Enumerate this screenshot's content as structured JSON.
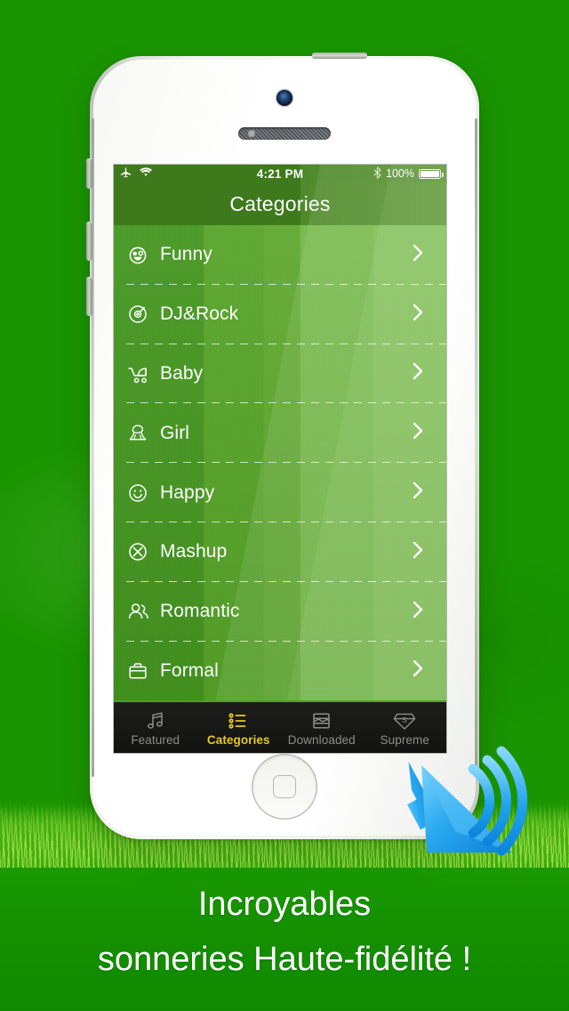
{
  "app": {
    "screen_title": "Categories",
    "caption_line1": "Incroyables",
    "caption_line2": "sonneries Haute-fidélité !"
  },
  "status_bar": {
    "airplane_icon": "airplane-icon",
    "wifi_icon": "wifi-icon",
    "time": "4:21 PM",
    "bluetooth_icon": "bluetooth-icon",
    "battery_percent": "100%",
    "battery_icon": "battery-full-icon"
  },
  "categories": [
    {
      "label": "Funny",
      "icon": "funny-face-icon"
    },
    {
      "label": "DJ&Rock",
      "icon": "vinyl-record-icon"
    },
    {
      "label": "Baby",
      "icon": "baby-stroller-icon"
    },
    {
      "label": "Girl",
      "icon": "girl-head-icon"
    },
    {
      "label": "Happy",
      "icon": "smiley-face-icon"
    },
    {
      "label": "Mashup",
      "icon": "x-circle-icon"
    },
    {
      "label": "Romantic",
      "icon": "couple-icon"
    },
    {
      "label": "Formal",
      "icon": "briefcase-icon"
    }
  ],
  "tabs": [
    {
      "label": "Featured",
      "icon": "music-note-icon",
      "active": false
    },
    {
      "label": "Categories",
      "icon": "bullet-list-icon",
      "active": true
    },
    {
      "label": "Downloaded",
      "icon": "inbox-tray-icon",
      "active": false
    },
    {
      "label": "Supreme",
      "icon": "diamond-s-icon",
      "active": false
    }
  ],
  "overlay": {
    "speaker_icon": "speaker-sound-waves-icon"
  },
  "colors": {
    "accent_active_tab": "#e8c824",
    "nav_bar_green": "#3d7a1b",
    "list_green": "#56a428",
    "tab_bar_dark": "#1d1d1b",
    "caption_panel_green": "#159000",
    "speaker_blue": "#2aa8ef"
  }
}
